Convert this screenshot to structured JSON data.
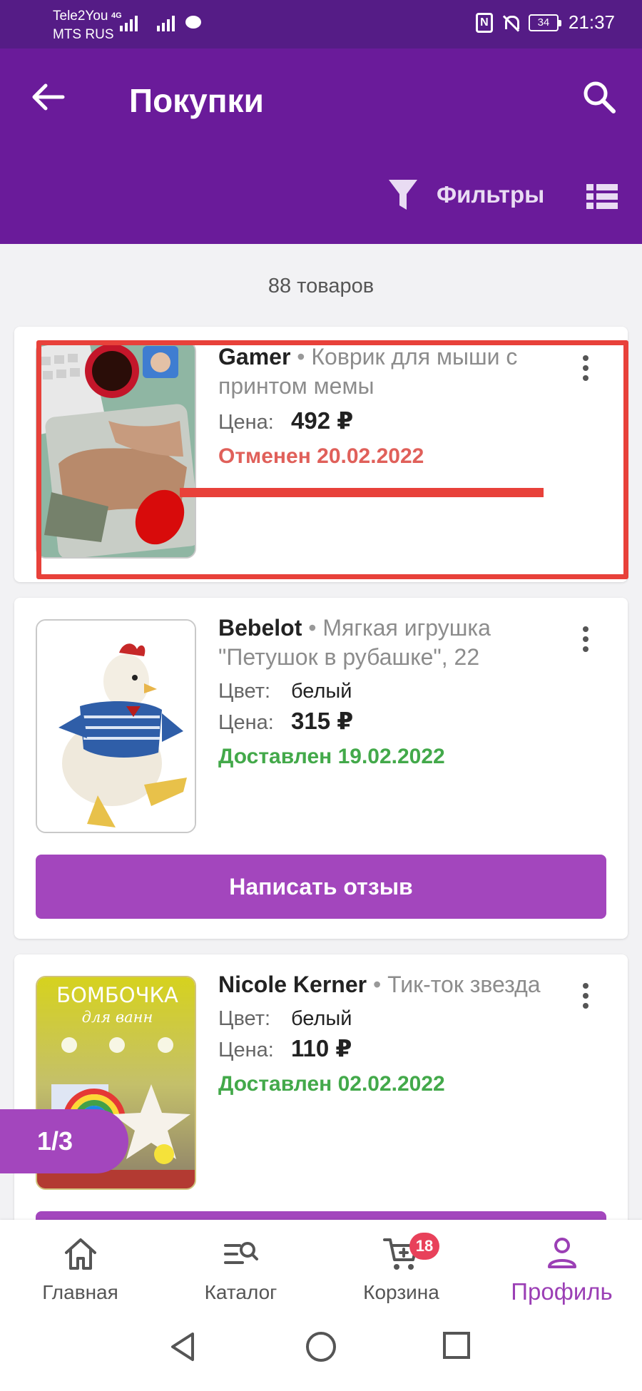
{
  "status_bar": {
    "carrier_1": "Tele2You",
    "carrier_2": "MTS RUS",
    "network_tag": "4G",
    "battery": "34",
    "time": "21:37"
  },
  "header": {
    "title": "Покупки",
    "filters_label": "Фильтры"
  },
  "items_count": "88 товаров",
  "orders": [
    {
      "brand": "Gamer",
      "description": "Коврик для мыши с принтом мемы",
      "price_label": "Цена:",
      "price": "492 ₽",
      "status": "Отменен 20.02.2022",
      "status_type": "cancelled"
    },
    {
      "brand": "Bebelot",
      "description": "Мягкая игрушка \"Петушок в рубашке\", 22",
      "color_label": "Цвет:",
      "color": "белый",
      "price_label": "Цена:",
      "price": "315 ₽",
      "status": "Доставлен 19.02.2022",
      "status_type": "delivered",
      "button": "Написать отзыв"
    },
    {
      "brand": "Nicole Kerner",
      "description": "Тик-ток звезда",
      "color_label": "Цвет:",
      "color": "белый",
      "price_label": "Цена:",
      "price": "110 ₽",
      "status": "Доставлен 02.02.2022",
      "status_type": "delivered",
      "thumb_title": "БОМБОЧКА",
      "thumb_subtitle": "для ванн"
    }
  ],
  "pager": "1/3",
  "bottom_nav": {
    "items": [
      {
        "label": "Главная",
        "icon": "home-icon"
      },
      {
        "label": "Каталог",
        "icon": "catalog-search-icon"
      },
      {
        "label": "Корзина",
        "icon": "cart-icon",
        "badge": "18"
      },
      {
        "label": "Профиль",
        "icon": "profile-icon",
        "active": true
      }
    ]
  },
  "colors": {
    "header": "#6a1b9a",
    "accent": "#a346bd",
    "cancelled": "#e0605a",
    "delivered": "#43a94a",
    "annotation": "#e8413a"
  }
}
